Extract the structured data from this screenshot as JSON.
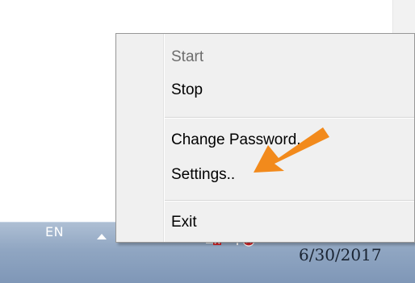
{
  "menu": {
    "items": [
      {
        "label": "Start",
        "enabled": false
      },
      {
        "label": "Stop",
        "enabled": true
      },
      {
        "label": "Change Password..",
        "enabled": true
      },
      {
        "label": "Settings..",
        "enabled": true
      },
      {
        "label": "Exit",
        "enabled": true
      }
    ]
  },
  "taskbar": {
    "language": "EN",
    "date": "6/30/2017",
    "tray_icons": [
      "app-icon",
      "speaker-icon",
      "network-error-icon",
      "action-center-flag-icon"
    ]
  },
  "annotation": {
    "color": "#f28a1c",
    "target": "Settings.."
  }
}
